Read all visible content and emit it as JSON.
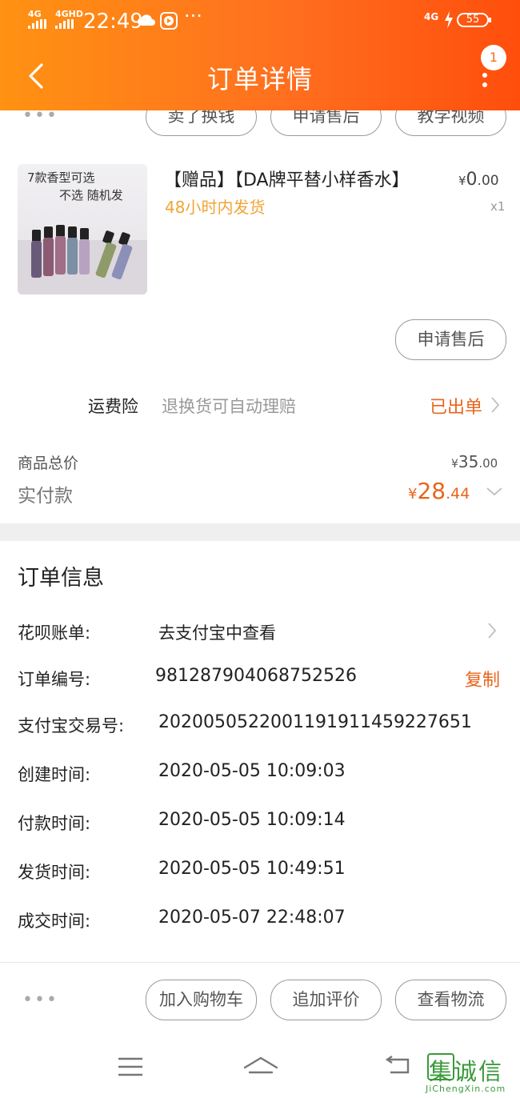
{
  "status_bar": {
    "signal1": "4G",
    "signal2": "4GHD",
    "time": "22:49",
    "extra": "···",
    "network": "4G",
    "battery": "55"
  },
  "header": {
    "title": "订单详情",
    "badge_count": "1"
  },
  "top_actions": [
    "卖了换钱",
    "申请售后",
    "教学视频"
  ],
  "product": {
    "image_caption1": "7款香型可选",
    "image_caption2": "不选 随机发",
    "name": "【赠品】【DA牌平替小样香水】",
    "shipping_note": "48小时内发货",
    "price_symbol": "¥",
    "price_int": "0",
    "price_dec": ".00",
    "quantity": "x1",
    "after_sale_button": "申请售后"
  },
  "insurance": {
    "label": "运费险",
    "description": "退换货可自动理赔",
    "status": "已出单"
  },
  "totals": {
    "goods_label": "商品总价",
    "goods_symbol": "¥",
    "goods_int": "35",
    "goods_dec": ".00",
    "paid_label": "实付款",
    "paid_symbol": "¥",
    "paid_int": "28",
    "paid_dec": ".44"
  },
  "order_info": {
    "title": "订单信息",
    "huabei_label": "花呗账单:",
    "huabei_value": "去支付宝中查看",
    "order_no_label": "订单编号:",
    "order_no_value": "981287904068752526",
    "copy_label": "复制",
    "alipay_label": "支付宝交易号:",
    "alipay_value": "2020050522001191911459227651",
    "created_label": "创建时间:",
    "created_value": "2020-05-05 10:09:03",
    "paid_time_label": "付款时间:",
    "paid_time_value": "2020-05-05 10:09:14",
    "shipped_label": "发货时间:",
    "shipped_value": "2020-05-05 10:49:51",
    "completed_label": "成交时间:",
    "completed_value": "2020-05-07 22:48:07"
  },
  "bottom_actions": [
    "加入购物车",
    "追加评价",
    "查看物流"
  ],
  "watermark": {
    "chars": "集诚信",
    "url": "JiChengXin.com"
  },
  "colors": {
    "header_start": "#ff9212",
    "header_end": "#ff4e0c",
    "accent_orange": "#e8651c",
    "shipping_note": "#f0a535"
  }
}
